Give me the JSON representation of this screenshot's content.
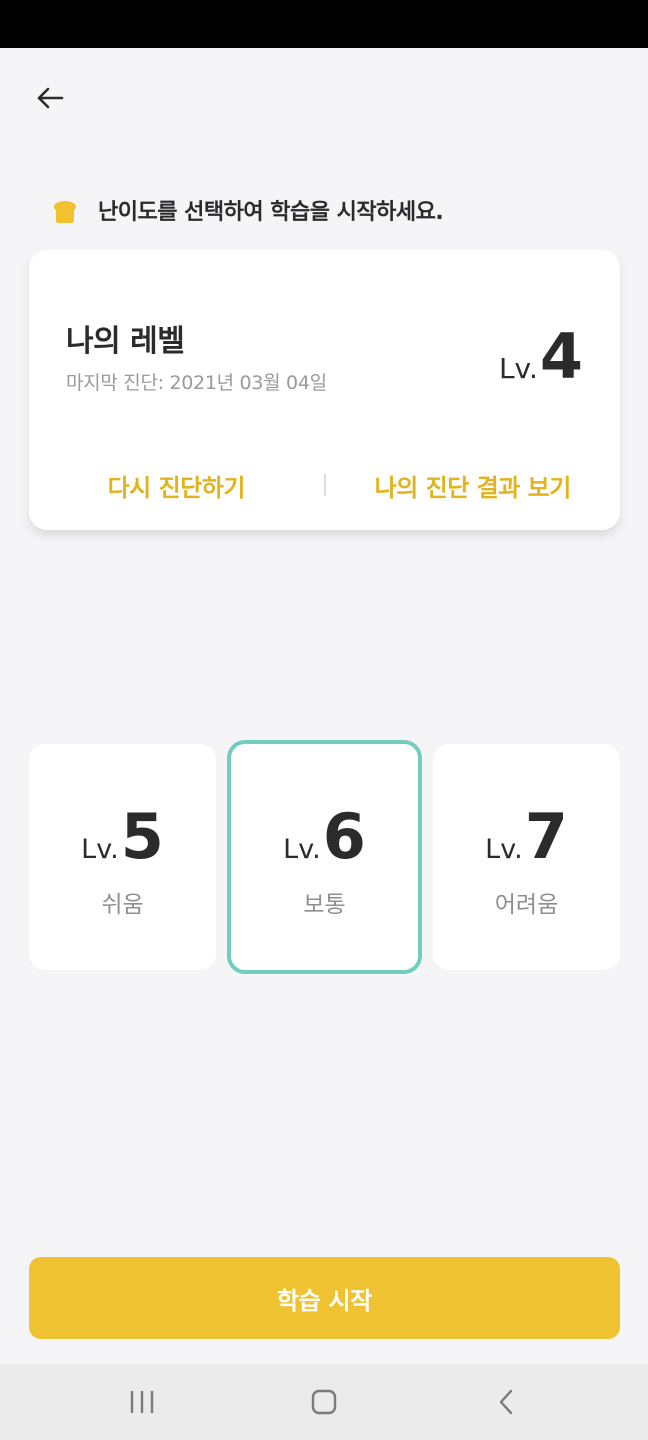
{
  "header": {
    "back_icon": "arrow-left-icon"
  },
  "guide": {
    "icon": "bread-icon",
    "text": "난이도를 선택하여 학습을 시작하세요.",
    "icon_color": "#f2c12e"
  },
  "my_level": {
    "title": "나의 레벨",
    "date": "마지막 진단: 2021년 03월 04일",
    "lv_prefix": "Lv.",
    "lv_value": "4",
    "rediagnose_label": "다시 진단하기",
    "result_label": "나의 진단 결과 보기"
  },
  "options": [
    {
      "lv_prefix": "Lv.",
      "lv_value": "5",
      "label": "쉬움",
      "selected": false
    },
    {
      "lv_prefix": "Lv.",
      "lv_value": "6",
      "label": "보통",
      "selected": true
    },
    {
      "lv_prefix": "Lv.",
      "lv_value": "7",
      "label": "어려움",
      "selected": false
    }
  ],
  "start_button": {
    "label": "학습 시작"
  },
  "nav_bar": {
    "recent_icon": "recent-apps-icon",
    "home_icon": "home-icon",
    "back_icon": "back-chevron-icon"
  },
  "colors": {
    "accent": "#efc231",
    "accent_text": "#e3b31f",
    "selected_border": "#72cdbf",
    "background": "#f5f5f7"
  }
}
